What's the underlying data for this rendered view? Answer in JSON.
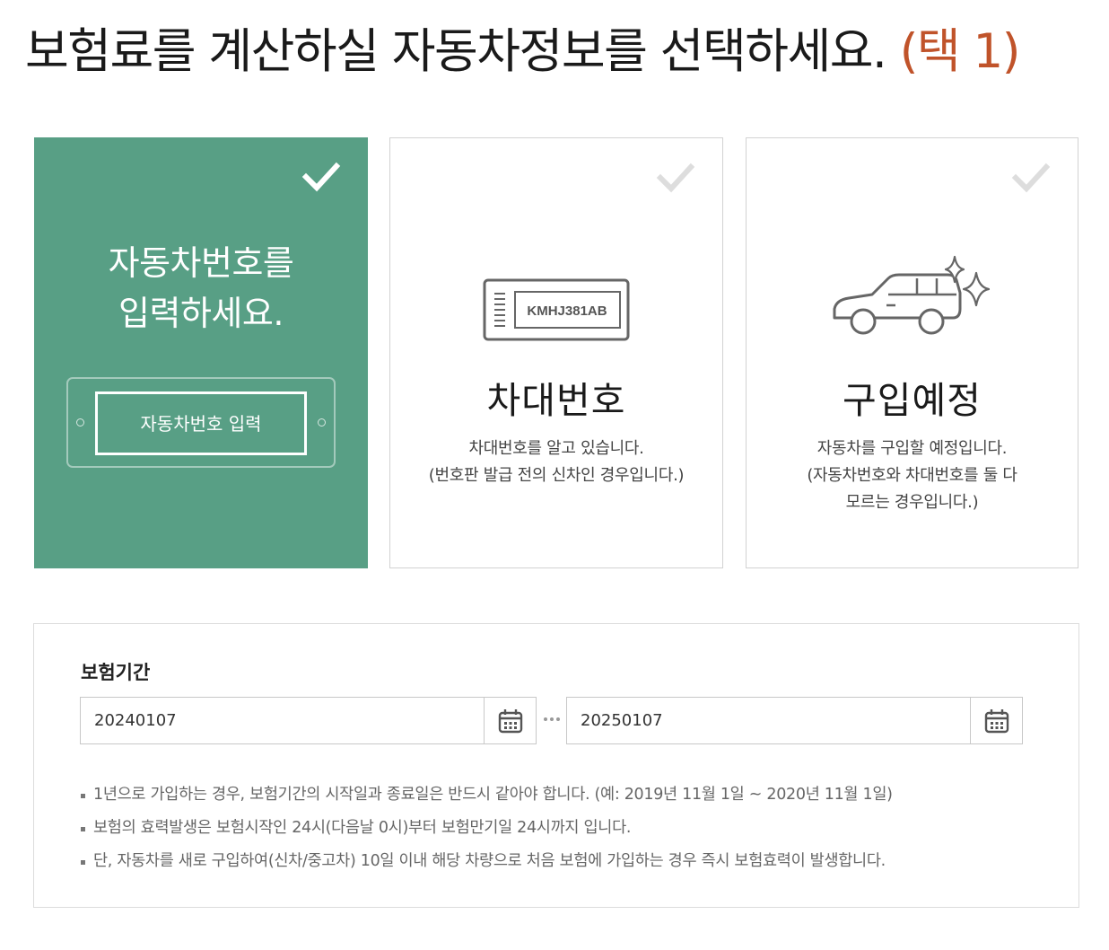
{
  "page": {
    "title": "보험료를 계산하실 자동차정보를 선택하세요.",
    "step": "(택 1)"
  },
  "options": {
    "plate": {
      "title_line1": "자동차번호를",
      "title_line2": "입력하세요.",
      "button_label": "자동차번호 입력",
      "selected": true
    },
    "chassis": {
      "heading": "차대번호",
      "plate_text": "KMHJ381AB",
      "desc_line1": "차대번호를 알고 있습니다.",
      "desc_line2": "(번호판 발급 전의 신차인 경우입니다.)",
      "selected": false
    },
    "purchase": {
      "heading": "구입예정",
      "desc_line1": "자동차를 구입할 예정입니다.",
      "desc_line2": "(자동차번호와 차대번호를 둘 다",
      "desc_line3": "모르는 경우입니다.)",
      "selected": false
    }
  },
  "period": {
    "label": "보험기간",
    "start_value": "20240107",
    "end_value": "20250107",
    "notes": [
      "1년으로 가입하는 경우, 보험기간의 시작일과 종료일은 반드시 같아야 합니다. (예: 2019년 11월 1일 ~ 2020년 11월 1일)",
      "보험의 효력발생은 보험시작인 24시(다음날 0시)부터 보험만기일 24시까지 입니다.",
      "단, 자동차를 새로 구입하여(신차/중고차) 10일 이내 해당 차량으로 처음 보험에 가입하는 경우 즉시 보험효력이 발생합니다."
    ]
  },
  "icons": {
    "check": "check-icon",
    "calendar": "calendar-icon",
    "license_plate": "license-plate-icon",
    "car": "car-icon",
    "sparkle": "sparkle-icon"
  },
  "colors": {
    "selected_card": "#589f85",
    "step_accent": "#c0532a",
    "check_inactive": "#dddddd"
  }
}
